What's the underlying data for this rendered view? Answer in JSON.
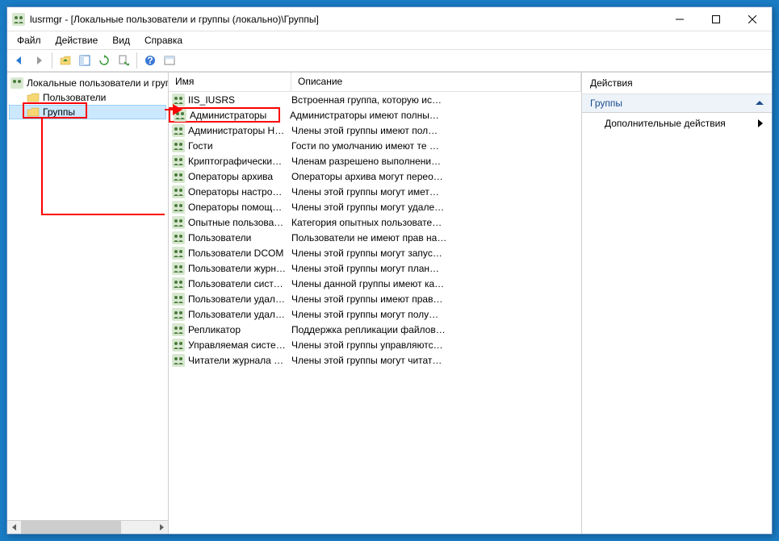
{
  "titlebar": {
    "text": "lusrmgr - [Локальные пользователи и группы (локально)\\Группы]"
  },
  "menu": {
    "file": "Файл",
    "action": "Действие",
    "view": "Вид",
    "help": "Справка"
  },
  "tree": {
    "root": "Локальные пользователи и группы",
    "users": "Пользователи",
    "groups": "Группы"
  },
  "list": {
    "col_name": "Имя",
    "col_desc": "Описание",
    "rows": [
      {
        "name": "IIS_IUSRS",
        "desc": "Встроенная группа, которую ис…"
      },
      {
        "name": "Администраторы",
        "desc": "Администраторы имеют полны…",
        "highlighted": true
      },
      {
        "name": "Администраторы Hy…",
        "desc": "Члены этой группы имеют пол…"
      },
      {
        "name": "Гости",
        "desc": "Гости по умолчанию имеют те …"
      },
      {
        "name": "Криптографические …",
        "desc": "Членам разрешено выполнени…"
      },
      {
        "name": "Операторы архива",
        "desc": "Операторы архива могут перео…"
      },
      {
        "name": "Операторы настройк…",
        "desc": "Члены этой группы могут имет…"
      },
      {
        "name": "Операторы помощи …",
        "desc": "Члены этой группы могут удале…"
      },
      {
        "name": "Опытные пользовате…",
        "desc": "Категория опытных пользовате…"
      },
      {
        "name": "Пользователи",
        "desc": "Пользователи не имеют прав на…"
      },
      {
        "name": "Пользователи DCOM",
        "desc": "Члены этой группы могут запуc…"
      },
      {
        "name": "Пользователи журна…",
        "desc": "Члены этой группы могут план…"
      },
      {
        "name": "Пользователи систе…",
        "desc": "Члены данной группы имеют ка…"
      },
      {
        "name": "Пользователи удале…",
        "desc": "Члены этой группы имеют прав…"
      },
      {
        "name": "Пользователи удале…",
        "desc": "Члены этой группы могут полу…"
      },
      {
        "name": "Репликатор",
        "desc": "Поддержка репликации файлов…"
      },
      {
        "name": "Управляемая систем…",
        "desc": "Члены этой группы управляютс…"
      },
      {
        "name": "Читатели журнала с…",
        "desc": "Члены этой группы могут читат…"
      }
    ]
  },
  "actions": {
    "header": "Действия",
    "group_heading": "Группы",
    "more_actions": "Дополнительные действия"
  }
}
